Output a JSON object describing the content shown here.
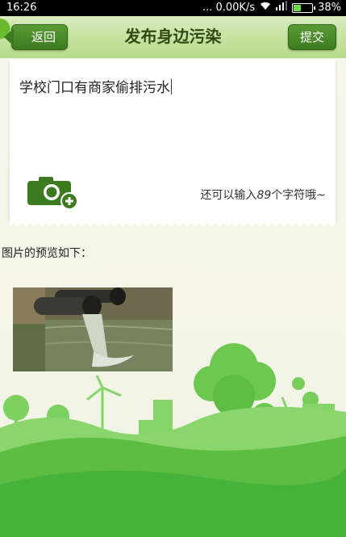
{
  "status_bar": {
    "time": "16:26",
    "network": "... 0.00K/s",
    "battery": "38%"
  },
  "header": {
    "back_label": "返回",
    "title": "发布身边污染",
    "submit_label": "提交"
  },
  "editor": {
    "text": "学校门口有商家偷排污水",
    "counter_prefix": "还可以输入",
    "counter_value": "89",
    "counter_suffix": "个字符哦~"
  },
  "preview": {
    "label": "图片的预览如下："
  },
  "icons": {
    "camera": "camera-add-icon",
    "wifi": "wifi-icon",
    "signal": "signal-icon",
    "battery": "battery-icon"
  },
  "colors": {
    "accent": "#3c7a20",
    "header_bg": "#c3e29b",
    "landscape_green": "#4fb43a"
  }
}
